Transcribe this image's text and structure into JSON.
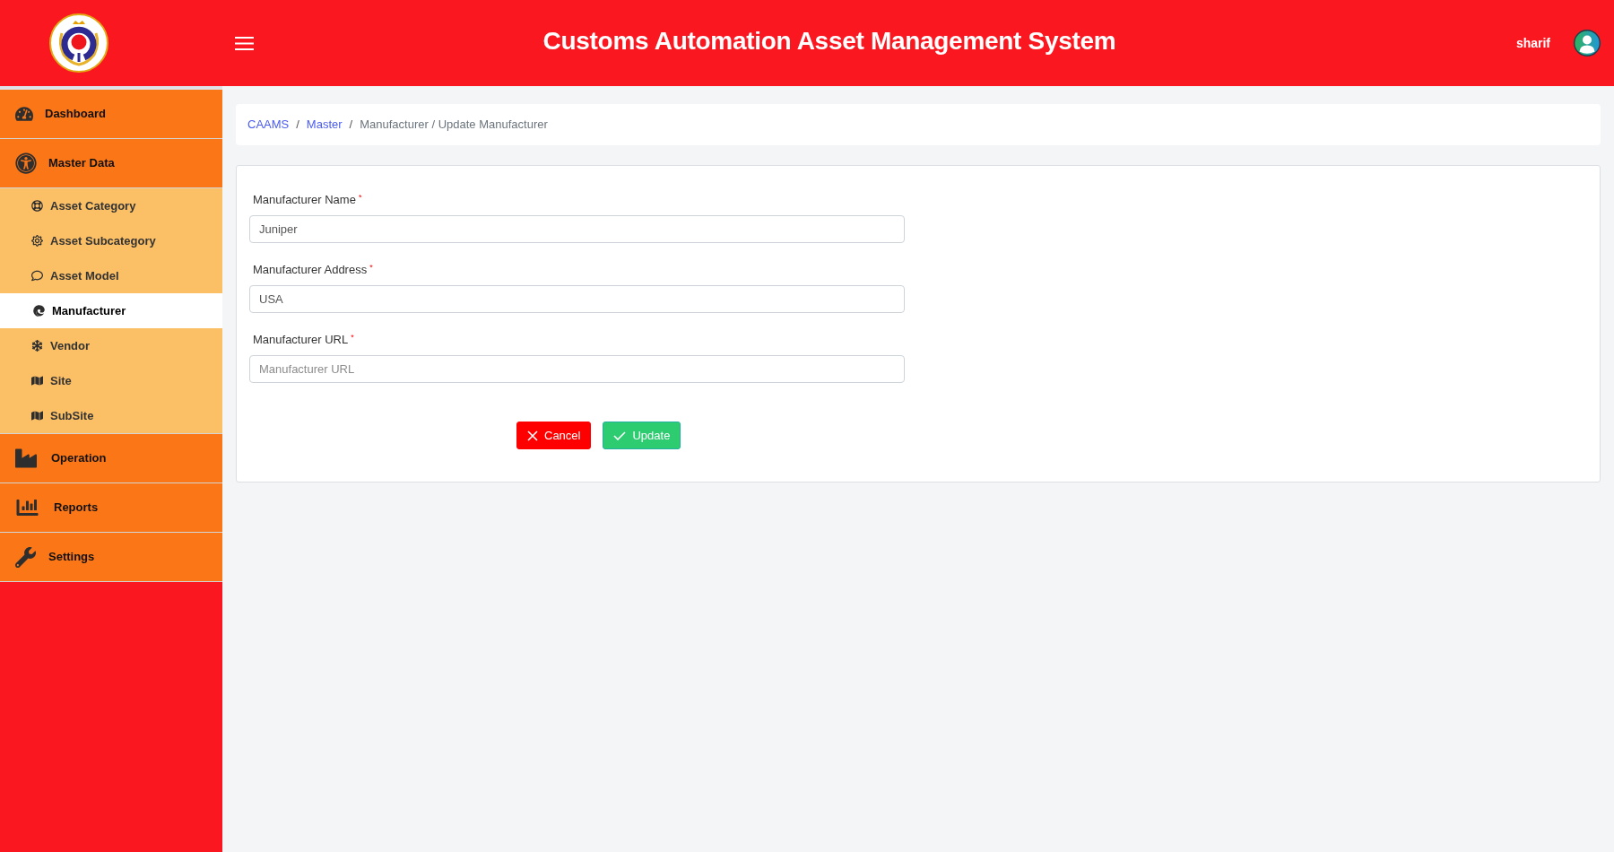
{
  "header": {
    "title": "Customs Automation Asset Management System",
    "user": {
      "name": "sharif"
    }
  },
  "sidebar": {
    "items": [
      {
        "label": "Dashboard",
        "selected": false
      },
      {
        "label": "Master Data",
        "selected": false,
        "expanded": true,
        "children": [
          {
            "label": "Asset Category",
            "selected": false
          },
          {
            "label": "Asset Subcategory",
            "selected": false
          },
          {
            "label": "Asset Model",
            "selected": false
          },
          {
            "label": "Manufacturer",
            "selected": true
          },
          {
            "label": "Vendor",
            "selected": false
          },
          {
            "label": "Site",
            "selected": false
          },
          {
            "label": "SubSite",
            "selected": false
          }
        ]
      },
      {
        "label": "Operation",
        "selected": false
      },
      {
        "label": "Reports",
        "selected": false
      },
      {
        "label": "Settings",
        "selected": false
      }
    ]
  },
  "breadcrumb": {
    "items": [
      {
        "label": "CAAMS",
        "link": true
      },
      {
        "label": "Master",
        "link": true
      },
      {
        "label": "Manufacturer / Update Manufacturer",
        "link": false
      }
    ],
    "separators": [
      "/",
      "/"
    ]
  },
  "form": {
    "fields": [
      {
        "label": "Manufacturer Name",
        "required_mark": "*",
        "value": "Juniper"
      },
      {
        "label": "Manufacturer Address",
        "required_mark": "*",
        "value": "USA"
      },
      {
        "label": "Manufacturer URL",
        "required_mark": "*",
        "placeholder": "Manufacturer URL"
      }
    ],
    "buttons": [
      {
        "kind": "cancel",
        "label": "Cancel"
      },
      {
        "kind": "update",
        "label": "Update"
      }
    ]
  }
}
